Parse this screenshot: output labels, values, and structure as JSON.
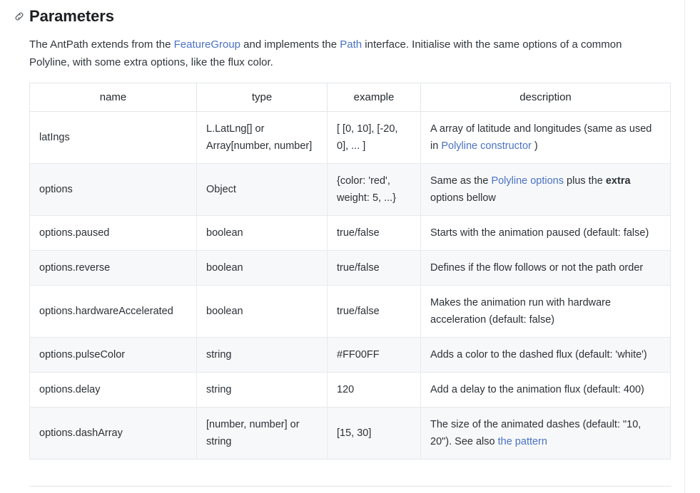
{
  "heading": {
    "icon": "link-anchor-icon",
    "title": "Parameters"
  },
  "intro": {
    "part1": "The AntPath extends from the ",
    "link1": "FeatureGroup",
    "part2": " and implements the ",
    "link2": "Path",
    "part3": " interface. Initialise with the same options of a common Polyline, with some extra options, like the flux color."
  },
  "colors": {
    "link": "#4a72c4",
    "text": "#24292e",
    "border": "#e3e6e8",
    "alt_row_bg": "#f7f8f9"
  },
  "table": {
    "columns": [
      "name",
      "type",
      "example",
      "description"
    ],
    "rows": [
      {
        "name": "latIngs",
        "type": "L.LatLng[] or Array[number, number]",
        "example": "[ [0, 10], [-20, 0], ... ]",
        "desc_before": "A array of latitude and longitudes (same as used in ",
        "desc_link": "Polyline constructor",
        "desc_after": " )"
      },
      {
        "name": "options",
        "type": "Object",
        "example": "{color: 'red', weight: 5, ...}",
        "desc_before": "Same as the ",
        "desc_link": "Polyline options",
        "desc_after": " plus the extra options bellow",
        "desc_bold": "extra"
      },
      {
        "name": "options.paused",
        "type": "boolean",
        "example": "true/false",
        "desc_before": "Starts with the animation paused (default: false)",
        "desc_link": "",
        "desc_after": ""
      },
      {
        "name": "options.reverse",
        "type": "boolean",
        "example": "true/false",
        "desc_before": "Defines if the flow follows or not the path order",
        "desc_link": "",
        "desc_after": ""
      },
      {
        "name": "options.hardwareAccelerated",
        "type": "boolean",
        "example": "true/false",
        "desc_before": "Makes the animation run with hardware acceleration (default: false)",
        "desc_link": "",
        "desc_after": ""
      },
      {
        "name": "options.pulseColor",
        "type": "string",
        "example": "#FF00FF",
        "desc_before": "Adds a color to the dashed flux (default: 'white')",
        "desc_link": "",
        "desc_after": ""
      },
      {
        "name": "options.delay",
        "type": "string",
        "example": "120",
        "desc_before": "Add a delay to the animation flux (default: 400)",
        "desc_link": "",
        "desc_after": ""
      },
      {
        "name": "options.dashArray",
        "type": "[number, number] or string",
        "example": "[15, 30]",
        "desc_before": "The size of the animated dashes (default: \"10, 20\"). See also ",
        "desc_link": "the pattern",
        "desc_after": ""
      }
    ]
  }
}
